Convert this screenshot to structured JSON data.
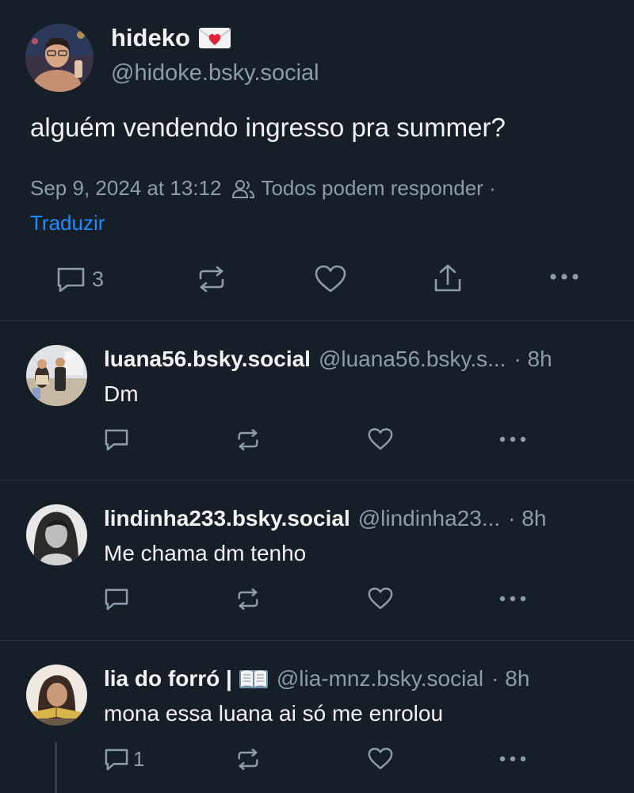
{
  "main_post": {
    "author_name": "hideko",
    "author_handle": "@hidoke.bsky.social",
    "text": "alguém vendendo ingresso pra summer?",
    "timestamp": "Sep 9, 2024 at 13:12",
    "reply_setting": "Todos podem responder ·",
    "translate_label": "Traduzir",
    "reply_count": "3"
  },
  "replies": [
    {
      "name": "luana56.bsky.social",
      "handle": "@luana56.bsky.s...",
      "time": "· 8h",
      "text": "Dm",
      "reply_count": ""
    },
    {
      "name": "lindinha233.bsky.social",
      "handle": "@lindinha23...",
      "time": "· 8h",
      "text": "Me chama dm tenho",
      "reply_count": ""
    },
    {
      "name": "lia do forró |",
      "handle": "@lia-mnz.bsky.social",
      "time": "· 8h",
      "text": "mona essa luana ai só me enrolou",
      "reply_count": "1"
    }
  ],
  "colors": {
    "background": "#161e27",
    "text_primary": "#f1f3f5",
    "text_muted": "#8d9bab",
    "accent": "#208bfe",
    "divider": "#2a3440"
  },
  "icons": {
    "reply": "speech-bubble-icon",
    "repost": "repost-arrows-icon",
    "like": "heart-icon",
    "share": "share-upload-icon",
    "more": "more-dots-icon",
    "audience": "people-icon",
    "name_emoji_main": "love-letter-envelope-icon",
    "name_emoji_lia": "open-book-icon"
  }
}
